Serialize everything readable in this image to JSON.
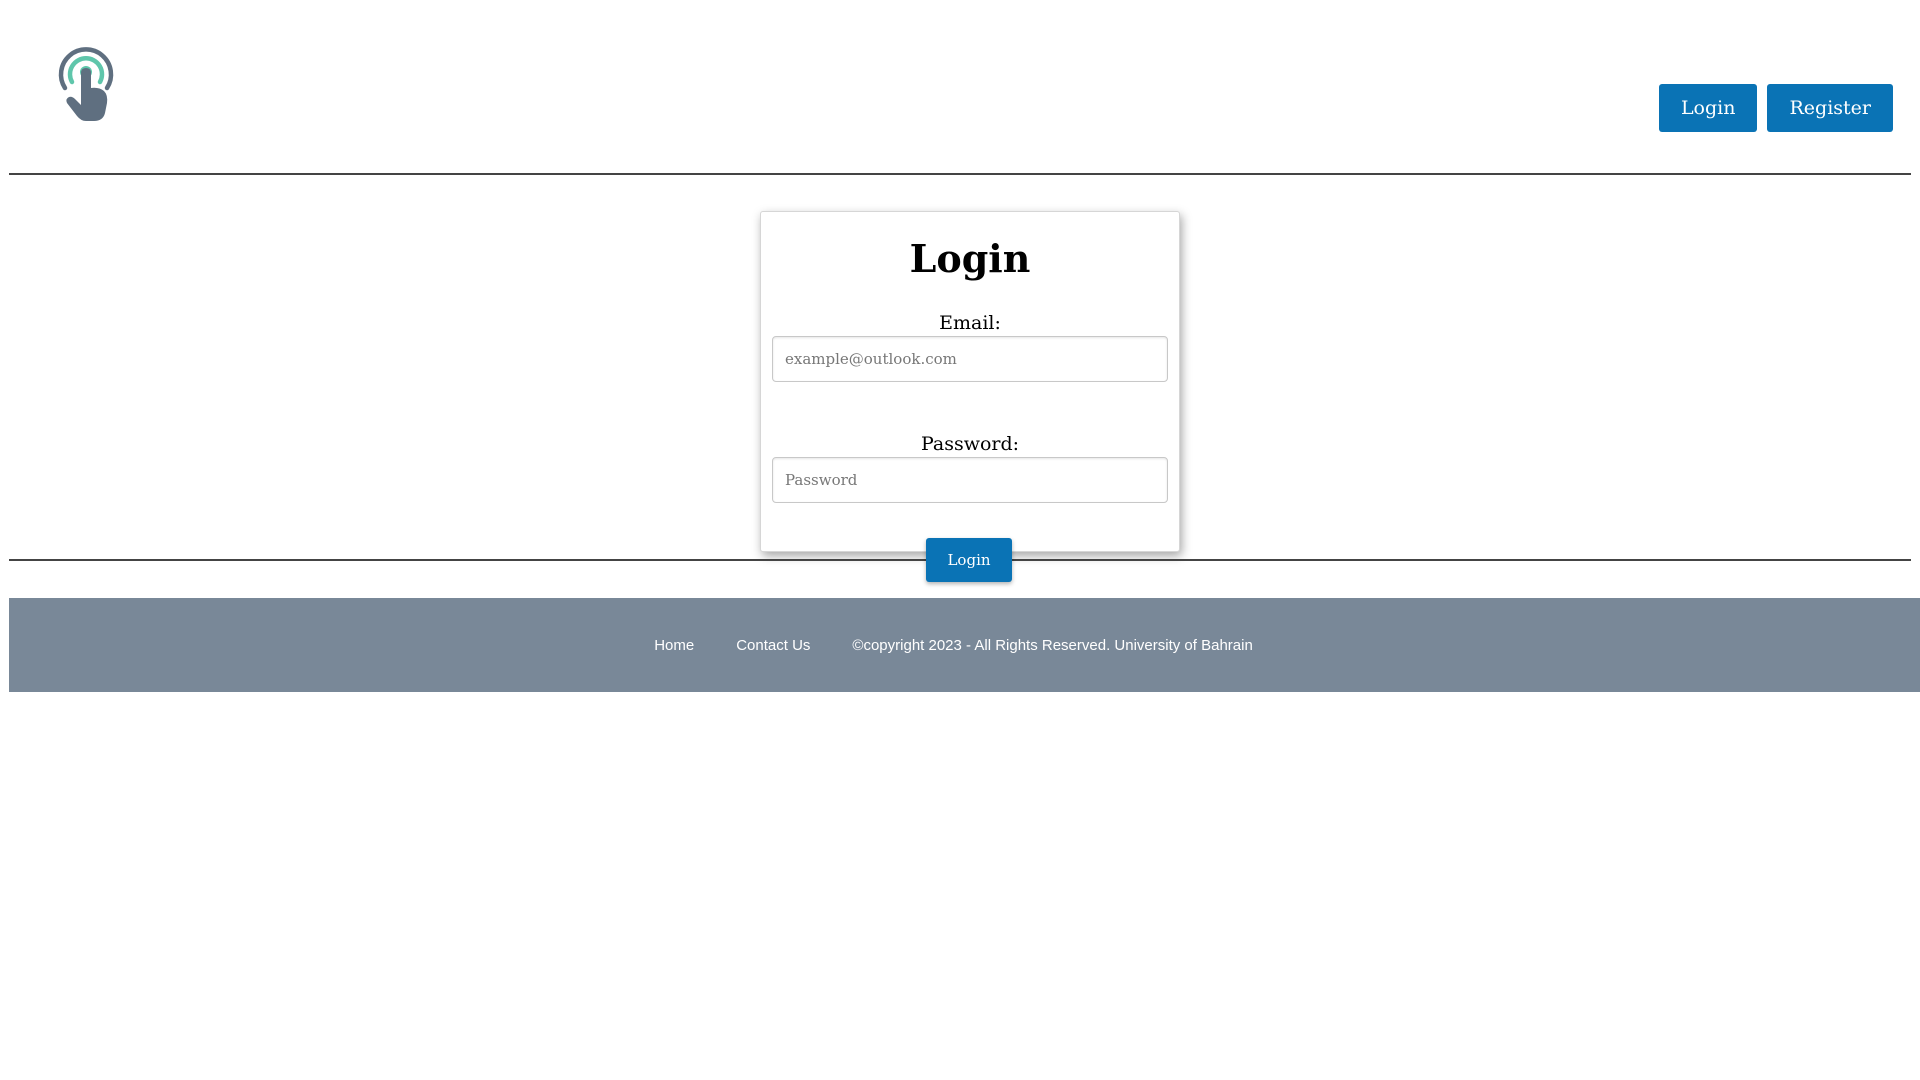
{
  "header": {
    "logo_icon": "touch-tap-icon",
    "nav": {
      "login_label": "Login",
      "register_label": "Register"
    }
  },
  "login_form": {
    "title": "Login",
    "email_label": "Email:",
    "email_placeholder": "example@outlook.com",
    "password_label": "Password:",
    "password_placeholder": "Password",
    "submit_label": "Login"
  },
  "footer": {
    "home_label": "Home",
    "contact_label": "Contact Us",
    "copyright": "©copyright 2023 - All Rights Reserved. University of Bahrain"
  },
  "colors": {
    "primary_button": "#0a73b5",
    "footer_background": "#798898",
    "logo_gray": "#5f6f80",
    "logo_teal": "#5fc6ab"
  }
}
